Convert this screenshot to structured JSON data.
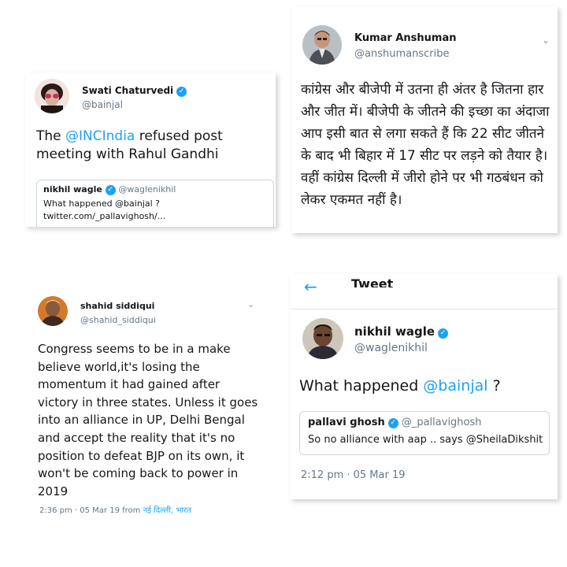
{
  "tweet1": {
    "name": "Swati Chaturvedi",
    "handle": "@bainjal",
    "text_before": "The ",
    "text_link": "@INCIndia",
    "text_after": " refused post meeting with Rahul Gandhi",
    "quote": {
      "name": "nikhil wagle",
      "handle": "@waglenikhil",
      "text": "What happened @bainjal ? twitter.com/_pallavighosh/..."
    }
  },
  "tweet2": {
    "name": "Kumar Anshuman",
    "handle": "@anshumanscribe",
    "text": "कांग्रेस और बीजेपी में उतना ही अंतर है जितना हार और जीत में। बीजेपी के जीतने की इच्छा का अंदाजा आप इसी बात से लगा सकते हैं कि 22 सीट जीतने के बाद भी बिहार में 17 सीट पर लड़ने को तैयार है। वहीं कांग्रेस दिल्ली में जीरो होने पर भी गठबंधन को लेकर एकमत नहीं है।"
  },
  "tweet3": {
    "name": "shahid siddiqui",
    "handle": "@shahid_siddiqui",
    "text": "Congress seems to be in a make believe world,it's losing the momentum it had gained after victory in three states. Unless it goes into an alliance in UP, Delhi Bengal and accept the reality that it's no position to defeat BJP on its own, it won't be coming back to power in 2019",
    "meta_time": "2:36 pm · 05 Mar 19 from ",
    "meta_place": "नई दिल्ली, भारत"
  },
  "tweet4": {
    "header_title": "Tweet",
    "name": "nikhil wagle",
    "handle": "@waglenikhil",
    "text_before": "What happened ",
    "text_link": "@bainjal",
    "text_after": " ?",
    "quote": {
      "name": "pallavi ghosh",
      "handle": "@_pallavighosh",
      "text": "So no alliance with aap .. says @SheilaDikshit"
    },
    "meta_time": "2:12 pm · 05 Mar 19"
  },
  "colors": {
    "link": "#1da1f2",
    "verified": "#1da1f2",
    "muted": "#657786"
  }
}
